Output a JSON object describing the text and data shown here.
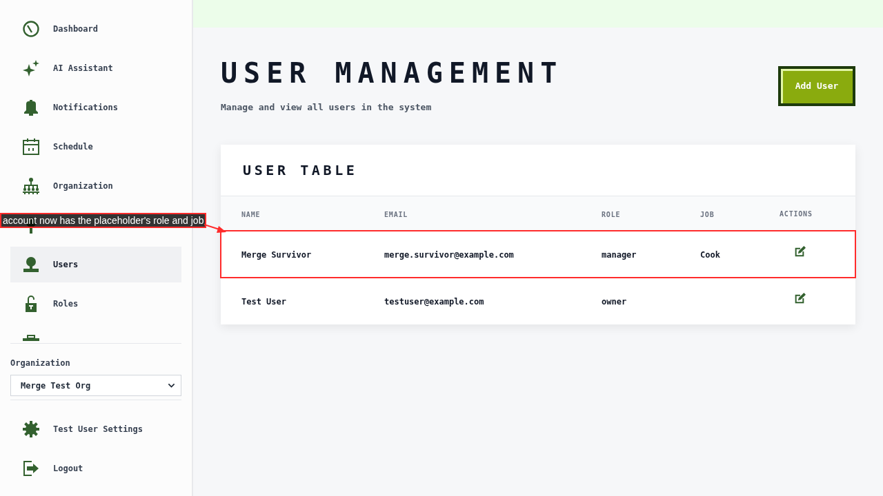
{
  "sidebar": {
    "nav_items": [
      {
        "label": "Dashboard",
        "selected": false
      },
      {
        "label": "AI Assistant",
        "selected": false
      },
      {
        "label": "Notifications",
        "selected": false
      },
      {
        "label": "Schedule",
        "selected": false
      },
      {
        "label": "Organization",
        "selected": false
      },
      {
        "selected": false
      },
      {
        "label": "Users",
        "selected": true
      },
      {
        "label": "Roles",
        "selected": false
      },
      {
        "selected": false
      }
    ],
    "organization_picker": {
      "label": "Organization",
      "value": "Merge Test Org"
    },
    "footer_items": [
      {
        "label": "Test User Settings"
      },
      {
        "label": "Logout"
      }
    ]
  },
  "header": {
    "title": "USER MANAGEMENT",
    "subtitle": "Manage and view all users in the system",
    "add_button": "Add User"
  },
  "user_table": {
    "title": "USER TABLE",
    "columns": [
      "NAME",
      "EMAIL",
      "ROLE",
      "JOB",
      "ACTIONS"
    ],
    "rows": [
      {
        "name": "Merge Survivor",
        "email": "merge.survivor@example.com",
        "role": "manager",
        "job": "Cook",
        "highlighted": true
      },
      {
        "name": "Test User",
        "email": "testuser@example.com",
        "role": "owner",
        "highlighted": false
      }
    ]
  },
  "annotation": {
    "text": "account now has the placeholder's role and job"
  }
}
